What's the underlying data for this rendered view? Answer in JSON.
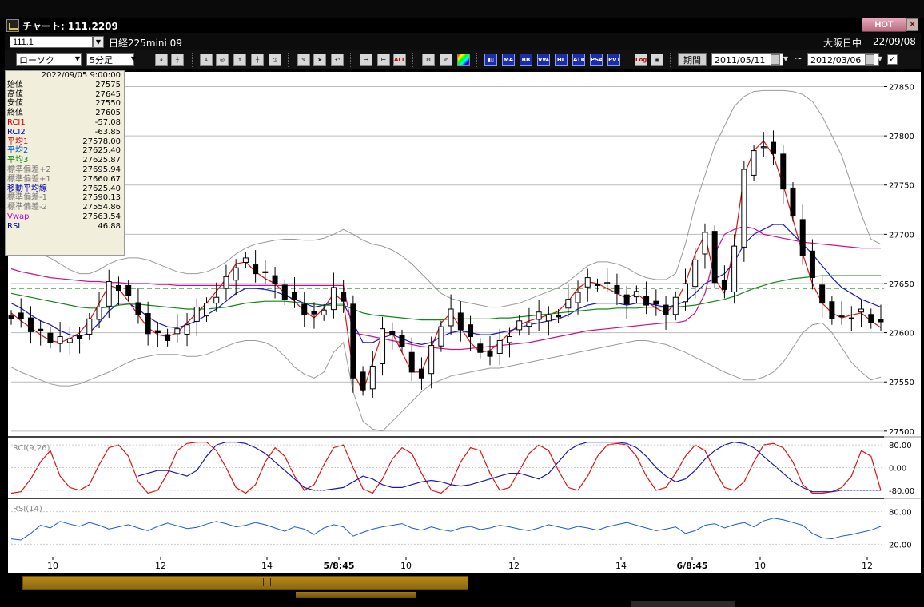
{
  "window": {
    "title": "チャート: 111.2209",
    "hot_label": "HOT",
    "close_label": "✕"
  },
  "header": {
    "code": "111.1",
    "instrument": "日経225mini 09",
    "market": "大阪日中",
    "date": "22/09/08"
  },
  "toolbar": {
    "chart_type": "ローソク",
    "period": "5分足",
    "indicator_buttons": [
      "MA",
      "BB",
      "VWAP",
      "HL",
      "ATR",
      "PSAR",
      "PVT",
      "Log"
    ],
    "period_button": "期間",
    "date_from": "2011/05/11",
    "date_to": "2012/03/06",
    "tilde": "~",
    "check": "✓"
  },
  "info_panel": {
    "datetime": "2022/09/05 9:00:00",
    "rows": [
      {
        "label": "始値",
        "value": "27575",
        "color": "#000000"
      },
      {
        "label": "高値",
        "value": "27645",
        "color": "#000000"
      },
      {
        "label": "安値",
        "value": "27550",
        "color": "#000000"
      },
      {
        "label": "終値",
        "value": "27605",
        "color": "#000000"
      },
      {
        "label": "RCI1",
        "value": "-57.08",
        "color": "#cc0000"
      },
      {
        "label": "RCI2",
        "value": "-63.85",
        "color": "#0000aa"
      },
      {
        "label": "平均1",
        "value": "27578.00",
        "color": "#cc0000"
      },
      {
        "label": "平均2",
        "value": "27625.40",
        "color": "#0055cc"
      },
      {
        "label": "平均3",
        "value": "27625.87",
        "color": "#008800"
      },
      {
        "label": "標準偏差+2",
        "value": "27695.94",
        "color": "#777777"
      },
      {
        "label": "標準偏差+1",
        "value": "27660.67",
        "color": "#777777"
      },
      {
        "label": "移動平均線",
        "value": "27625.40",
        "color": "#0000aa"
      },
      {
        "label": "標準偏差-1",
        "value": "27590.13",
        "color": "#777777"
      },
      {
        "label": "標準偏差-2",
        "value": "27554.86",
        "color": "#777777"
      },
      {
        "label": "Vwap",
        "value": "27563.54",
        "color": "#cc00cc"
      },
      {
        "label": "RSI",
        "value": "46.88",
        "color": "#0000aa"
      }
    ]
  },
  "chart_data": {
    "type": "line",
    "title": "",
    "price_axis": {
      "ticks": [
        27500,
        27550,
        27600,
        27650,
        27700,
        27750,
        27800,
        27850
      ],
      "ylim": [
        27495,
        27865
      ]
    },
    "reference_line": 27645,
    "time_ticks": [
      "10",
      "12",
      "14",
      "5/8:45",
      "10",
      "12",
      "14",
      "6/8:45",
      "10",
      "12"
    ],
    "series": [
      {
        "name": "平均1",
        "color": "#dd1111",
        "values": [
          27620,
          27612,
          27605,
          27598,
          27592,
          27590,
          27594,
          27600,
          27612,
          27630,
          27648,
          27645,
          27632,
          27618,
          27605,
          27598,
          27596,
          27600,
          27610,
          27620,
          27630,
          27642,
          27655,
          27670,
          27672,
          27662,
          27655,
          27650,
          27640,
          27632,
          27622,
          27615,
          27625,
          27640,
          27632,
          27560,
          27540,
          27570,
          27600,
          27600,
          27580,
          27560,
          27560,
          27585,
          27610,
          27620,
          27605,
          27590,
          27580,
          27582,
          27590,
          27600,
          27608,
          27612,
          27615,
          27618,
          27622,
          27632,
          27645,
          27652,
          27650,
          27645,
          27640,
          27635,
          27640,
          27632,
          27625,
          27620,
          27630,
          27650,
          27680,
          27700,
          27655,
          27640,
          27690,
          27760,
          27785,
          27795,
          27780,
          27750,
          27715,
          27680,
          27650,
          27630,
          27620,
          27615,
          27618,
          27620,
          27612,
          27605
        ]
      },
      {
        "name": "平均2",
        "color": "#1818cc",
        "values": [
          27630,
          27625,
          27618,
          27612,
          27608,
          27602,
          27598,
          27596,
          27600,
          27610,
          27622,
          27630,
          27630,
          27624,
          27616,
          27610,
          27606,
          27605,
          27608,
          27612,
          27618,
          27624,
          27632,
          27640,
          27645,
          27645,
          27644,
          27642,
          27638,
          27634,
          27630,
          27626,
          27628,
          27630,
          27630,
          27610,
          27590,
          27590,
          27595,
          27598,
          27594,
          27590,
          27588,
          27590,
          27596,
          27600,
          27602,
          27600,
          27598,
          27598,
          27600,
          27602,
          27605,
          27608,
          27610,
          27612,
          27614,
          27618,
          27624,
          27628,
          27630,
          27630,
          27630,
          27628,
          27630,
          27630,
          27628,
          27626,
          27628,
          27632,
          27640,
          27650,
          27655,
          27660,
          27672,
          27690,
          27700,
          27705,
          27710,
          27710,
          27700,
          27690,
          27680,
          27668,
          27656,
          27646,
          27640,
          27634,
          27630,
          27626
        ]
      },
      {
        "name": "平均3",
        "color": "#118811",
        "values": [
          27640,
          27638,
          27636,
          27634,
          27632,
          27630,
          27628,
          27626,
          27625,
          27625,
          27626,
          27628,
          27629,
          27629,
          27628,
          27627,
          27626,
          27625,
          27624,
          27624,
          27624,
          27625,
          27626,
          27628,
          27630,
          27631,
          27632,
          27632,
          27632,
          27631,
          27630,
          27629,
          27628,
          27628,
          27628,
          27624,
          27620,
          27618,
          27617,
          27616,
          27615,
          27614,
          27613,
          27613,
          27613,
          27614,
          27614,
          27614,
          27614,
          27614,
          27615,
          27615,
          27616,
          27617,
          27618,
          27619,
          27620,
          27621,
          27622,
          27623,
          27624,
          27624,
          27625,
          27625,
          27625,
          27626,
          27626,
          27626,
          27626,
          27627,
          27628,
          27630,
          27632,
          27634,
          27637,
          27641,
          27645,
          27648,
          27651,
          27653,
          27655,
          27656,
          27657,
          27658,
          27658,
          27658,
          27658,
          27658,
          27658,
          27658
        ]
      },
      {
        "name": "Vwap",
        "color": "#cc1188",
        "values": [
          27665,
          27662,
          27660,
          27658,
          27656,
          27655,
          27654,
          27653,
          27652,
          27652,
          27651,
          27651,
          27650,
          27650,
          27650,
          27649,
          27649,
          27648,
          27648,
          27648,
          27648,
          27648,
          27648,
          27648,
          27648,
          27648,
          27648,
          27648,
          27648,
          27648,
          27648,
          27648,
          27648,
          27648,
          27648,
          27600,
          27598,
          27596,
          27594,
          27592,
          27590,
          27588,
          27586,
          27585,
          27584,
          27583,
          27583,
          27584,
          27585,
          27586,
          27587,
          27588,
          27589,
          27590,
          27592,
          27594,
          27596,
          27598,
          27600,
          27602,
          27603,
          27604,
          27605,
          27606,
          27607,
          27608,
          27609,
          27610,
          27610,
          27612,
          27620,
          27640,
          27680,
          27700,
          27705,
          27708,
          27706,
          27700,
          27698,
          27696,
          27694,
          27692,
          27691,
          27690,
          27689,
          27688,
          27687,
          27686,
          27686,
          27686
        ]
      },
      {
        "name": "標準偏差+2",
        "color": "#999999",
        "values": [
          27690,
          27688,
          27684,
          27680,
          27676,
          27670,
          27664,
          27660,
          27660,
          27664,
          27670,
          27674,
          27676,
          27676,
          27674,
          27670,
          27666,
          27662,
          27660,
          27660,
          27662,
          27666,
          27672,
          27680,
          27686,
          27690,
          27692,
          27694,
          27695,
          27695,
          27694,
          27694,
          27696,
          27700,
          27705,
          27700,
          27694,
          27690,
          27688,
          27684,
          27678,
          27670,
          27660,
          27650,
          27640,
          27635,
          27632,
          27630,
          27628,
          27626,
          27626,
          27628,
          27630,
          27634,
          27638,
          27642,
          27646,
          27652,
          27660,
          27668,
          27672,
          27672,
          27670,
          27666,
          27660,
          27656,
          27654,
          27654,
          27660,
          27690,
          27730,
          27760,
          27790,
          27810,
          27830,
          27840,
          27845,
          27846,
          27846,
          27846,
          27845,
          27842,
          27835,
          27820,
          27800,
          27780,
          27750,
          27720,
          27695,
          27690
        ]
      },
      {
        "name": "標準偏差-2",
        "color": "#999999",
        "values": [
          27565,
          27560,
          27556,
          27552,
          27548,
          27546,
          27546,
          27548,
          27552,
          27556,
          27560,
          27565,
          27570,
          27574,
          27576,
          27578,
          27578,
          27578,
          27576,
          27576,
          27578,
          27582,
          27586,
          27590,
          27592,
          27592,
          27590,
          27585,
          27576,
          27565,
          27558,
          27554,
          27560,
          27580,
          27590,
          27540,
          27510,
          27502,
          27500,
          27510,
          27520,
          27530,
          27540,
          27548,
          27552,
          27556,
          27558,
          27560,
          27562,
          27564,
          27564,
          27566,
          27568,
          27570,
          27572,
          27574,
          27576,
          27578,
          27580,
          27582,
          27584,
          27586,
          27588,
          27590,
          27592,
          27592,
          27590,
          27588,
          27584,
          27580,
          27575,
          27570,
          27565,
          27560,
          27556,
          27552,
          27552,
          27555,
          27560,
          27570,
          27585,
          27600,
          27608,
          27610,
          27600,
          27585,
          27570,
          27560,
          27552,
          27555
        ]
      },
      {
        "name": "RCI1",
        "color": "#dd1111",
        "panel": "rci",
        "values": [
          -90,
          -85,
          -40,
          20,
          60,
          -30,
          -70,
          -80,
          -60,
          10,
          70,
          80,
          40,
          -50,
          -90,
          -80,
          -20,
          60,
          85,
          90,
          90,
          60,
          0,
          -70,
          -90,
          -60,
          20,
          70,
          40,
          -30,
          -80,
          -60,
          10,
          70,
          80,
          0,
          -75,
          -90,
          -40,
          30,
          70,
          50,
          -20,
          -80,
          -90,
          -60,
          20,
          70,
          60,
          -20,
          -80,
          -70,
          -10,
          50,
          80,
          60,
          -10,
          -70,
          -80,
          -30,
          40,
          80,
          85,
          80,
          40,
          -30,
          -80,
          -70,
          -20,
          40,
          80,
          60,
          -10,
          -70,
          -80,
          -50,
          20,
          80,
          85,
          70,
          20,
          -60,
          -90,
          -90,
          -85,
          -70,
          -30,
          60,
          40,
          -80
        ]
      },
      {
        "name": "RCI2",
        "color": "#1818aa",
        "panel": "rci",
        "values": [
          null,
          null,
          null,
          null,
          null,
          null,
          null,
          null,
          null,
          null,
          null,
          null,
          null,
          -30,
          -20,
          -10,
          -10,
          -20,
          -30,
          -10,
          40,
          80,
          90,
          90,
          85,
          70,
          50,
          20,
          -10,
          -40,
          -70,
          -80,
          -80,
          -75,
          -70,
          -50,
          -30,
          -40,
          -60,
          -70,
          -70,
          -60,
          -50,
          -45,
          -50,
          -60,
          -65,
          -60,
          -50,
          -40,
          -30,
          -20,
          -20,
          -30,
          -40,
          -20,
          20,
          60,
          80,
          90,
          90,
          90,
          90,
          85,
          70,
          40,
          0,
          -30,
          -50,
          -40,
          -10,
          30,
          60,
          80,
          90,
          85,
          70,
          40,
          10,
          -20,
          -50,
          -70,
          -85,
          -85,
          -85,
          -80,
          -80,
          -80,
          -80,
          -80
        ]
      },
      {
        "name": "RSI",
        "color": "#1a5ad8",
        "panel": "rsi",
        "values": [
          30,
          28,
          40,
          55,
          50,
          62,
          57,
          53,
          60,
          55,
          48,
          52,
          56,
          50,
          45,
          53,
          59,
          54,
          49,
          51,
          57,
          62,
          58,
          52,
          55,
          60,
          56,
          50,
          44,
          52,
          48,
          38,
          50,
          56,
          52,
          35,
          42,
          48,
          52,
          55,
          58,
          50,
          46,
          52,
          47,
          44,
          50,
          53,
          47,
          50,
          55,
          52,
          48,
          45,
          50,
          56,
          52,
          48,
          53,
          50,
          46,
          52,
          56,
          60,
          55,
          50,
          45,
          48,
          52,
          40,
          45,
          55,
          58,
          50,
          56,
          60,
          52,
          63,
          68,
          65,
          60,
          55,
          40,
          32,
          30,
          35,
          38,
          42,
          46,
          53
        ]
      }
    ],
    "rci_panel": {
      "label": "RCI(9,26)",
      "ticks": [
        80,
        0,
        -80
      ],
      "tick_labels": [
        "80.00",
        "0.00",
        "-80.00"
      ],
      "ylim": [
        -100,
        100
      ]
    },
    "rsi_panel": {
      "label": "RSI(14)",
      "ticks": [
        80,
        20
      ],
      "tick_labels": [
        "80.00",
        "20.00"
      ],
      "ylim": [
        0,
        100
      ]
    }
  },
  "colors": {
    "background": "#000000",
    "chart_bg": "#ffffff",
    "candle_up": "#ffffff",
    "candle_down": "#000000",
    "scroll_thumb": "#b88a18"
  }
}
